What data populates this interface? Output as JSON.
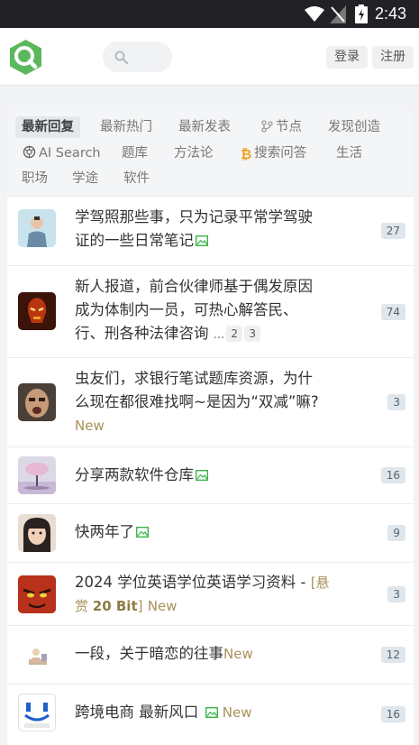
{
  "statusbar": {
    "time": "2:43"
  },
  "header": {
    "login": "登录",
    "register": "注册"
  },
  "tabs": [
    {
      "label": "最新回复"
    },
    {
      "label": "最新热门"
    },
    {
      "label": "最新发表"
    },
    {
      "label": "节点"
    },
    {
      "label": "发现创造"
    },
    {
      "label": "AI Search"
    },
    {
      "label": "题库"
    },
    {
      "label": "方法论"
    },
    {
      "label": "搜索问答"
    },
    {
      "label": "生活"
    },
    {
      "label": "职场"
    },
    {
      "label": "学途"
    },
    {
      "label": "软件"
    }
  ],
  "topics": [
    {
      "line1": "学驾照那些事，只为记录平常学驾驶",
      "line2": "证的一些日常笔记",
      "count": "27"
    },
    {
      "line1": "新人报道，前合伙律师基于偶发原因",
      "line2": "成为体制内一员，可热心解答民、",
      "line3": "行、刑各种法律咨询",
      "ellipsis": "...",
      "page2": "2",
      "page3": "3",
      "count": "74"
    },
    {
      "line1": "虫友们，求银行笔试题库资源，为什",
      "line2": "么现在都很难找啊~是因为“双减”嘛?",
      "new": "New",
      "count": "3"
    },
    {
      "line1": "分享两款软件仓库",
      "count": "16"
    },
    {
      "line1": "快两年了",
      "count": "9"
    },
    {
      "line1": "2024 学位英语学位英语学习资料 - ",
      "reward_open": "[悬",
      "reward_mid": "赏 ",
      "reward_num": "20 Bit",
      "reward_close": "]",
      "new": "New",
      "count": "3"
    },
    {
      "line1": "一段，关于暗恋的往事",
      "new": "New",
      "count": "12"
    },
    {
      "line1": "跨境电商 最新风口",
      "new": "New",
      "count": "16"
    }
  ]
}
